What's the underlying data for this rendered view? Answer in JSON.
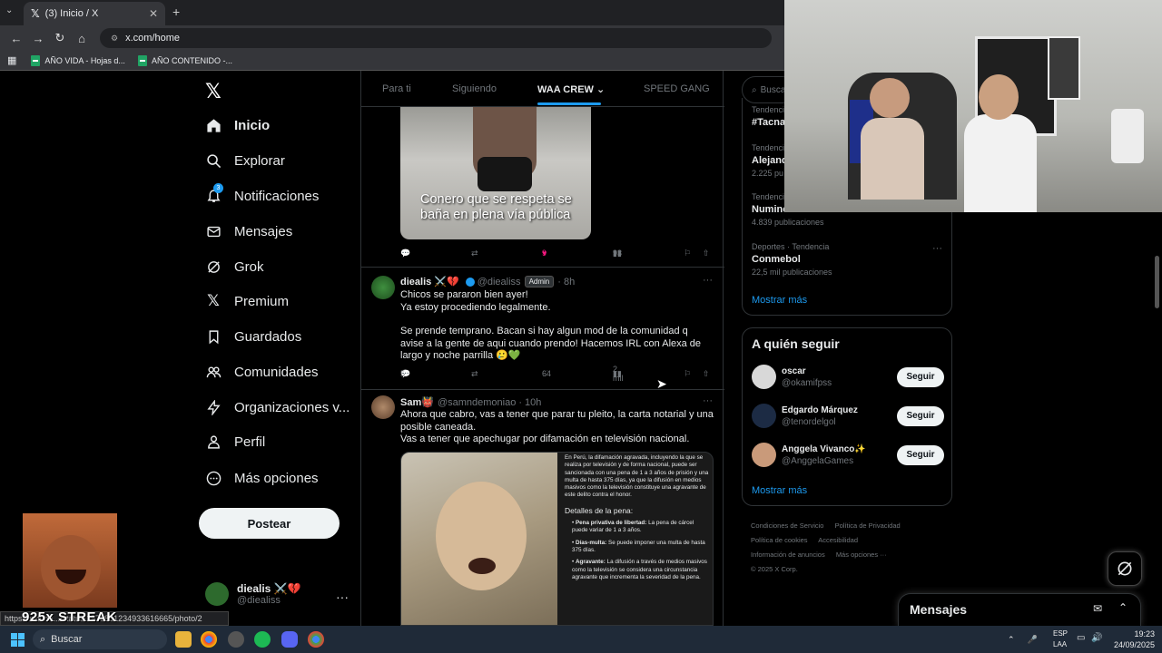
{
  "browser": {
    "tab_title": "(3) Inicio / X",
    "url": "x.com/home",
    "bookmarks": [
      {
        "label": "AÑO VIDA - Hojas d..."
      },
      {
        "label": "AÑO CONTENIDO -..."
      }
    ],
    "status_url": "https://x.com/.../status/1970851234933616665/photo/2"
  },
  "sidebar": {
    "items": [
      {
        "label": "Inicio",
        "icon": "home-icon"
      },
      {
        "label": "Explorar",
        "icon": "search-icon"
      },
      {
        "label": "Notificaciones",
        "icon": "bell-icon",
        "badge": "3"
      },
      {
        "label": "Mensajes",
        "icon": "envelope-icon"
      },
      {
        "label": "Grok",
        "icon": "grok-icon"
      },
      {
        "label": "Premium",
        "icon": "x-icon"
      },
      {
        "label": "Guardados",
        "icon": "bookmark-icon"
      },
      {
        "label": "Comunidades",
        "icon": "people-icon"
      },
      {
        "label": "Organizaciones v...",
        "icon": "bolt-icon"
      },
      {
        "label": "Perfil",
        "icon": "person-icon"
      },
      {
        "label": "Más opciones",
        "icon": "more-circle-icon"
      }
    ],
    "post_button": "Postear",
    "profile": {
      "name": "diealis ⚔️💔",
      "handle": "@diealiss"
    }
  },
  "feed": {
    "tabs": [
      "Para ti",
      "Siguiendo",
      "WAA CREW",
      "SPEED GANG"
    ],
    "active_tab": "WAA CREW",
    "tweet0": {
      "image_caption": "Conero que se respeta se baña en plena vía pública",
      "likes": "9",
      "views": "93"
    },
    "tweet1": {
      "name": "diealis ⚔️💔",
      "handle": "@diealiss",
      "badge": "Admin",
      "time": "· 8h",
      "text1": "Chicos se pararon bien ayer!",
      "text2": "Ya estoy procediendo legalmente.",
      "text3": "Se prende temprano. Bacan si hay algun mod de la comunidad q avise a la gente de aqui cuando prendo! Hacemos IRL con Alexa de largo y noche parrilla 🥲💚",
      "replies": "5",
      "likes": "64",
      "views": "2 mil"
    },
    "tweet2": {
      "name": "Sam👹",
      "handle": "@samndemoniao",
      "time": "· 10h",
      "text1": "Ahora que cabro, vas a tener que parar tu pleito, la carta notarial y una posible caneada.",
      "text2": "Vas a tener que apechugar por difamación en televisión nacional.",
      "panel_intro": "En Perú, la difamación agravada, incluyendo la que se realiza por televisión y de forma nacional, puede ser sancionada con una pena de 1 a 3 años de prisión y una multa de hasta 375 días, ya que la difusión en medios masivos como la televisión constituye una agravante de este delito contra el honor.",
      "panel_heading": "Detalles de la pena:",
      "b1_title": "Pena privativa de libertad:",
      "b1_text": "La pena de cárcel puede variar de 1 a 3 años.",
      "b2_title": "Días-multa:",
      "b2_text": "Se puede imponer una multa de hasta 375 días.",
      "b3_title": "Agravante:",
      "b3_text": "La difusión a través de medios masivos como la televisión se considera una circunstancia agravante que incrementa la severidad de la pena."
    }
  },
  "right": {
    "search_placeholder": "Busca",
    "trends": [
      {
        "category": "Tendencia",
        "title": "#Tacna",
        "count": ""
      },
      {
        "category": "Tendencia",
        "title": "Alejand",
        "count": "2.225 pu"
      },
      {
        "category": "Tendencia",
        "title": "Numinc",
        "count": "4.839 publicaciones"
      },
      {
        "category": "Deportes · Tendencia",
        "title": "Conmebol",
        "count": "22,5 mil publicaciones"
      }
    ],
    "show_more": "Mostrar más",
    "follow_title": "A quién seguir",
    "follow": [
      {
        "name": "oscar",
        "handle": "@okamifpss",
        "button": "Seguir"
      },
      {
        "name": "Edgardo Márquez",
        "handle": "@tenordelgol",
        "button": "Seguir"
      },
      {
        "name": "Anggela Vivanco✨",
        "handle": "@AnggelaGames",
        "button": "Seguir"
      }
    ],
    "show_more2": "Mostrar más",
    "footer": [
      "Condiciones de Servicio",
      "Política de Privacidad",
      "Política de cookies",
      "Accesibilidad",
      "Información de anuncios",
      "Más opciones ···",
      "© 2025 X Corp."
    ],
    "messages_drawer": "Mensajes"
  },
  "overlay": {
    "streak": "925x STREAK"
  },
  "taskbar": {
    "search": "Buscar",
    "lang1": "ESP",
    "lang2": "LAA",
    "time": "19:23",
    "date": "24/09/2025"
  },
  "colors": {
    "accent": "#1d9bf0",
    "like": "#f91880",
    "bg": "#000000"
  }
}
